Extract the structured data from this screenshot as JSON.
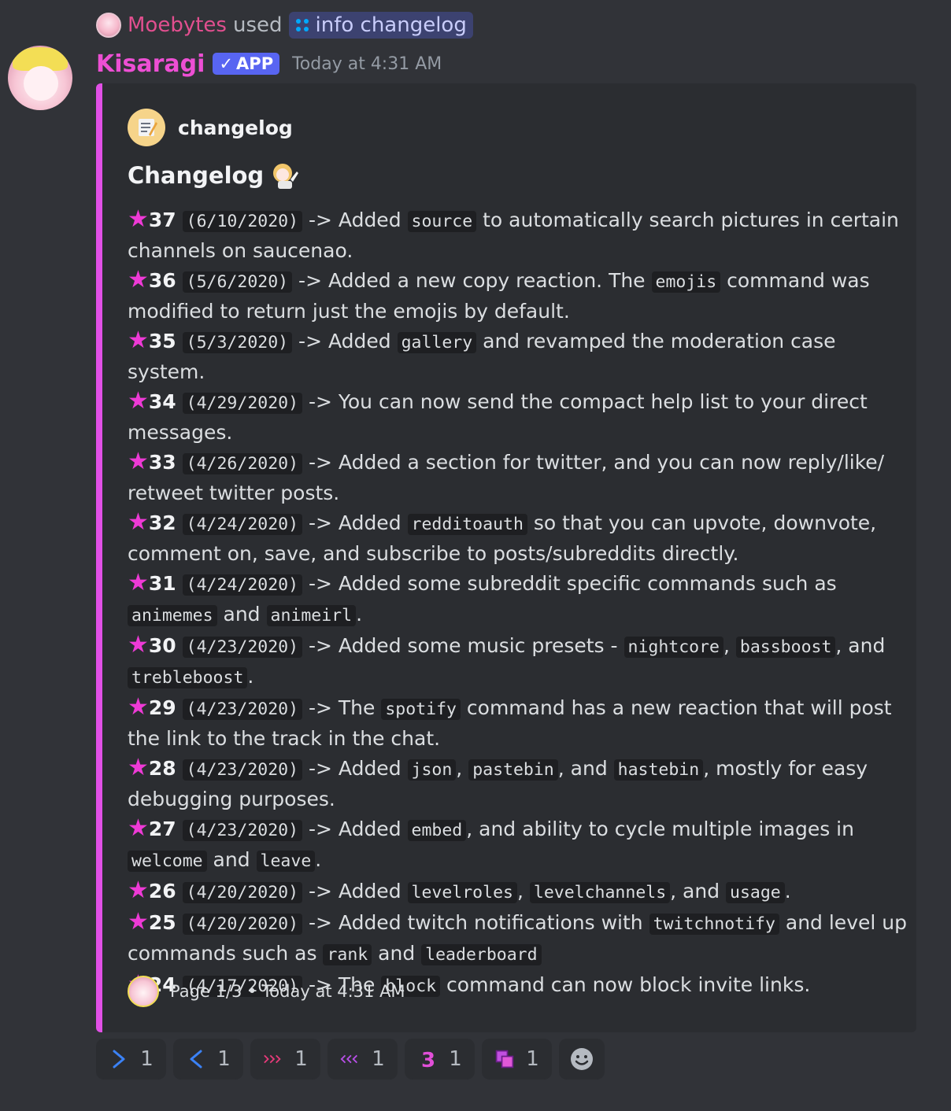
{
  "reply": {
    "user": "Moebytes",
    "used_text": "used",
    "command": "info changelog"
  },
  "message": {
    "bot_name": "Kisaragi",
    "badge": "APP",
    "timestamp": "Today at 4:31 AM"
  },
  "embed": {
    "accent_color": "#e150e6",
    "author": "changelog",
    "title": "Changelog",
    "entries": [
      {
        "num": "37",
        "date": "(6/10/2020)",
        "parts": [
          [
            "t",
            " -> Added "
          ],
          [
            "c",
            "source"
          ],
          [
            "t",
            " to automatically search pictures in certain channels on saucenao."
          ]
        ]
      },
      {
        "num": "36",
        "date": "(5/6/2020)",
        "parts": [
          [
            "t",
            " -> Added a new copy reaction. The "
          ],
          [
            "c",
            "emojis"
          ],
          [
            "t",
            " command was modified to return just the emojis by default."
          ]
        ]
      },
      {
        "num": "35",
        "date": "(5/3/2020)",
        "parts": [
          [
            "t",
            " -> Added "
          ],
          [
            "c",
            "gallery"
          ],
          [
            "t",
            " and revamped the moderation case system."
          ]
        ]
      },
      {
        "num": "34",
        "date": "(4/29/2020)",
        "parts": [
          [
            "t",
            " -> You can now send the compact help list to your direct messages."
          ]
        ]
      },
      {
        "num": "33",
        "date": "(4/26/2020)",
        "parts": [
          [
            "t",
            " -> Added a section for twitter, and you can now reply/like/ retweet twitter posts."
          ]
        ]
      },
      {
        "num": "32",
        "date": "(4/24/2020)",
        "parts": [
          [
            "t",
            " -> Added "
          ],
          [
            "c",
            "redditoauth"
          ],
          [
            "t",
            " so that you can upvote, downvote, comment on, save, and subscribe to posts/subreddits directly."
          ]
        ]
      },
      {
        "num": "31",
        "date": "(4/24/2020)",
        "parts": [
          [
            "t",
            " -> Added some subreddit specific commands such as "
          ],
          [
            "c",
            "animemes"
          ],
          [
            "t",
            " and "
          ],
          [
            "c",
            "animeirl"
          ],
          [
            "t",
            "."
          ]
        ]
      },
      {
        "num": "30",
        "date": "(4/23/2020)",
        "parts": [
          [
            "t",
            " -> Added some music presets - "
          ],
          [
            "c",
            "nightcore"
          ],
          [
            "t",
            ", "
          ],
          [
            "c",
            "bassboost"
          ],
          [
            "t",
            ", and "
          ],
          [
            "c",
            "trebleboost"
          ],
          [
            "t",
            "."
          ]
        ]
      },
      {
        "num": "29",
        "date": "(4/23/2020)",
        "parts": [
          [
            "t",
            " -> The "
          ],
          [
            "c",
            "spotify"
          ],
          [
            "t",
            " command has a new reaction that will post the link to the track in the chat."
          ]
        ]
      },
      {
        "num": "28",
        "date": "(4/23/2020)",
        "parts": [
          [
            "t",
            " -> Added "
          ],
          [
            "c",
            "json"
          ],
          [
            "t",
            ", "
          ],
          [
            "c",
            "pastebin"
          ],
          [
            "t",
            ", and "
          ],
          [
            "c",
            "hastebin"
          ],
          [
            "t",
            ", mostly for easy debugging purposes."
          ]
        ]
      },
      {
        "num": "27",
        "date": "(4/23/2020)",
        "parts": [
          [
            "t",
            " -> Added "
          ],
          [
            "c",
            "embed"
          ],
          [
            "t",
            ", and ability to cycle multiple images in "
          ],
          [
            "c",
            "welcome"
          ],
          [
            "t",
            " and "
          ],
          [
            "c",
            "leave"
          ],
          [
            "t",
            "."
          ]
        ]
      },
      {
        "num": "26",
        "date": "(4/20/2020)",
        "parts": [
          [
            "t",
            " -> Added "
          ],
          [
            "c",
            "levelroles"
          ],
          [
            "t",
            ", "
          ],
          [
            "c",
            "levelchannels"
          ],
          [
            "t",
            ", and "
          ],
          [
            "c",
            "usage"
          ],
          [
            "t",
            "."
          ]
        ]
      },
      {
        "num": "25",
        "date": "(4/20/2020)",
        "parts": [
          [
            "t",
            " -> Added twitch notifications with "
          ],
          [
            "c",
            "twitchnotify"
          ],
          [
            "t",
            " and level up commands such as "
          ],
          [
            "c",
            "rank"
          ],
          [
            "t",
            " and "
          ],
          [
            "c",
            "leaderboard"
          ]
        ]
      },
      {
        "num": "24",
        "date": "(4/17/2020)",
        "parts": [
          [
            "t",
            " -> The "
          ],
          [
            "c",
            "block"
          ],
          [
            "t",
            " command can now block invite links."
          ]
        ]
      }
    ],
    "footer": "Page 1/3 • Today at 4:31 AM"
  },
  "reactions": [
    {
      "icon": "right-chevron-icon",
      "count": "1"
    },
    {
      "icon": "left-chevron-icon",
      "count": "1"
    },
    {
      "icon": "fast-forward-icon",
      "count": "1"
    },
    {
      "icon": "rewind-icon",
      "count": "1"
    },
    {
      "icon": "number-three-icon",
      "count": "1"
    },
    {
      "icon": "copy-icon",
      "count": "1"
    }
  ]
}
